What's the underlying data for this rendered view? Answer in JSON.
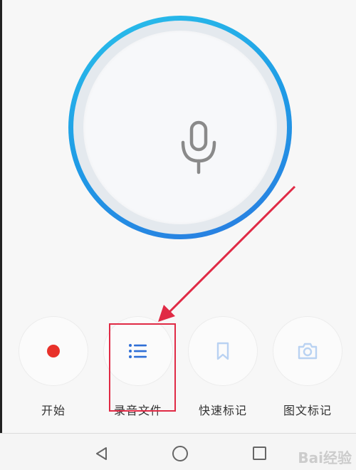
{
  "recorder": {
    "mic_icon": "microphone-icon",
    "ring_color": "#2a9fe8"
  },
  "actions": [
    {
      "label": "开始",
      "icon": "record-dot-icon",
      "color": "#e8312a"
    },
    {
      "label": "录音文件",
      "icon": "list-icon",
      "color": "#2f6fd6"
    },
    {
      "label": "快速标记",
      "icon": "bookmark-icon",
      "color": "#b9d2f2"
    },
    {
      "label": "图文标记",
      "icon": "camera-icon",
      "color": "#b9d2f2"
    }
  ],
  "annotation": {
    "highlight_color": "#e02a45"
  },
  "navbar": {
    "back_icon": "triangle-back-icon",
    "home_icon": "circle-home-icon",
    "recent_icon": "square-recents-icon"
  },
  "watermark": {
    "text": "Bai经验"
  }
}
